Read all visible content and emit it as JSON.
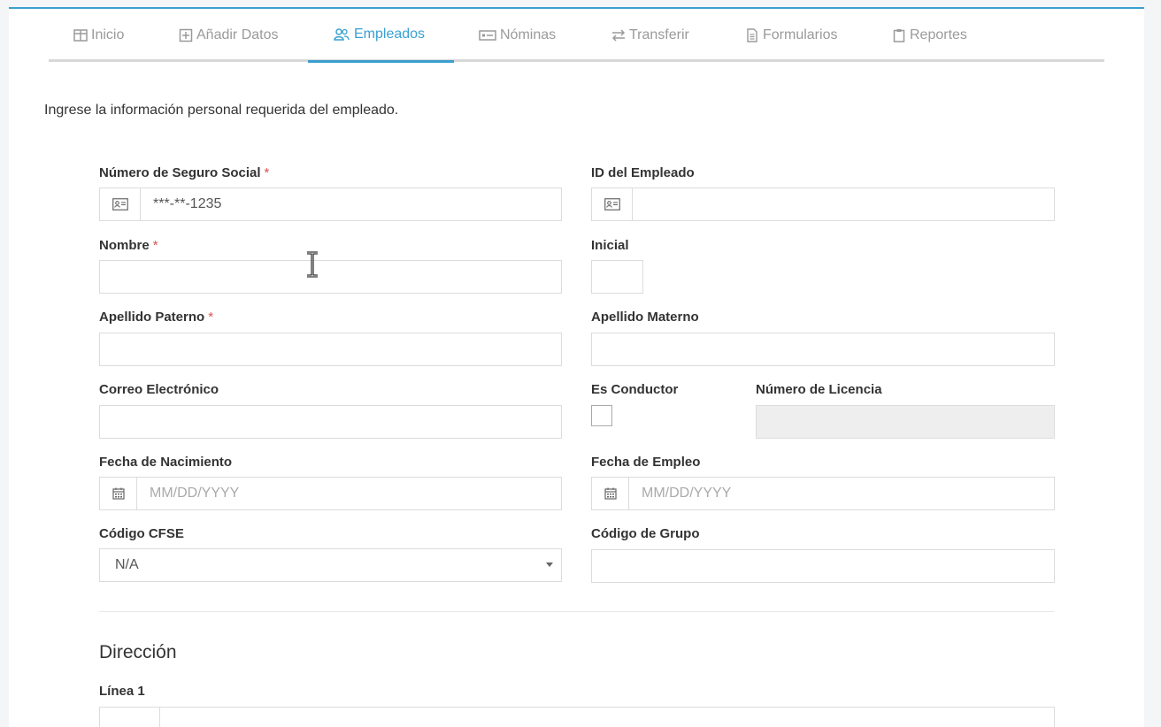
{
  "tabs": [
    {
      "label": "Inicio",
      "icon": "table-icon",
      "active": false
    },
    {
      "label": "Añadir Datos",
      "icon": "plus-square-icon",
      "active": false
    },
    {
      "label": "Empleados",
      "icon": "users-icon",
      "active": true
    },
    {
      "label": "Nóminas",
      "icon": "money-icon",
      "active": false
    },
    {
      "label": "Transferir",
      "icon": "exchange-icon",
      "active": false
    },
    {
      "label": "Formularios",
      "icon": "file-icon",
      "active": false
    },
    {
      "label": "Reportes",
      "icon": "clipboard-icon",
      "active": false
    }
  ],
  "intro": "Ingrese la información personal requerida del empleado.",
  "form": {
    "ssn": {
      "label": "Número de Seguro Social",
      "required": "*",
      "value": "***-**-1235"
    },
    "employee_id": {
      "label": "ID del Empleado",
      "value": ""
    },
    "first_name": {
      "label": "Nombre",
      "required": "*",
      "value": ""
    },
    "initial": {
      "label": "Inicial",
      "value": ""
    },
    "last_name": {
      "label": "Apellido Paterno",
      "required": "*",
      "value": ""
    },
    "mother_last_name": {
      "label": "Apellido Materno",
      "value": ""
    },
    "email": {
      "label": "Correo Electrónico",
      "value": ""
    },
    "is_driver": {
      "label": "Es Conductor",
      "checked": false
    },
    "license_number": {
      "label": "Número de Licencia",
      "value": "",
      "disabled": true
    },
    "birth_date": {
      "label": "Fecha de Nacimiento",
      "placeholder": "MM/DD/YYYY"
    },
    "hire_date": {
      "label": "Fecha de Empleo",
      "placeholder": "MM/DD/YYYY"
    },
    "cfse_code": {
      "label": "Código CFSE",
      "value": "N/A"
    },
    "group_code": {
      "label": "Código de Grupo",
      "value": ""
    }
  },
  "address": {
    "title": "Dirección",
    "line1": {
      "label": "Línea 1",
      "value": ""
    }
  },
  "colors": {
    "accent": "#3a9fd0",
    "required": "#d9534f"
  }
}
